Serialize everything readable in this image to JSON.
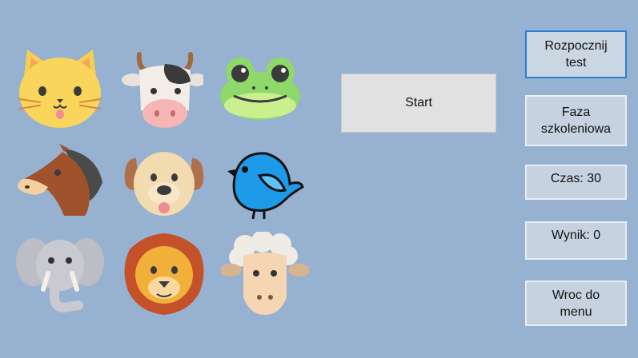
{
  "animals": [
    {
      "name": "cat-icon"
    },
    {
      "name": "cow-icon"
    },
    {
      "name": "frog-icon"
    },
    {
      "name": "horse-icon"
    },
    {
      "name": "dog-icon"
    },
    {
      "name": "bird-icon"
    },
    {
      "name": "elephant-icon"
    },
    {
      "name": "lion-icon"
    },
    {
      "name": "sheep-icon"
    }
  ],
  "start_label": "Start",
  "sidebar": {
    "start_test": "Rozpocznij\ntest",
    "training": "Faza\nszkoleniowa",
    "time": "Czas: 30",
    "score": "Wynik: 0",
    "back": "Wroc do\nmenu"
  },
  "colors": {
    "background": "#97b1d1",
    "button_bg": "#c6d2e0",
    "primary_border": "#2a7fd4",
    "start_bg": "#e1e1e1"
  }
}
